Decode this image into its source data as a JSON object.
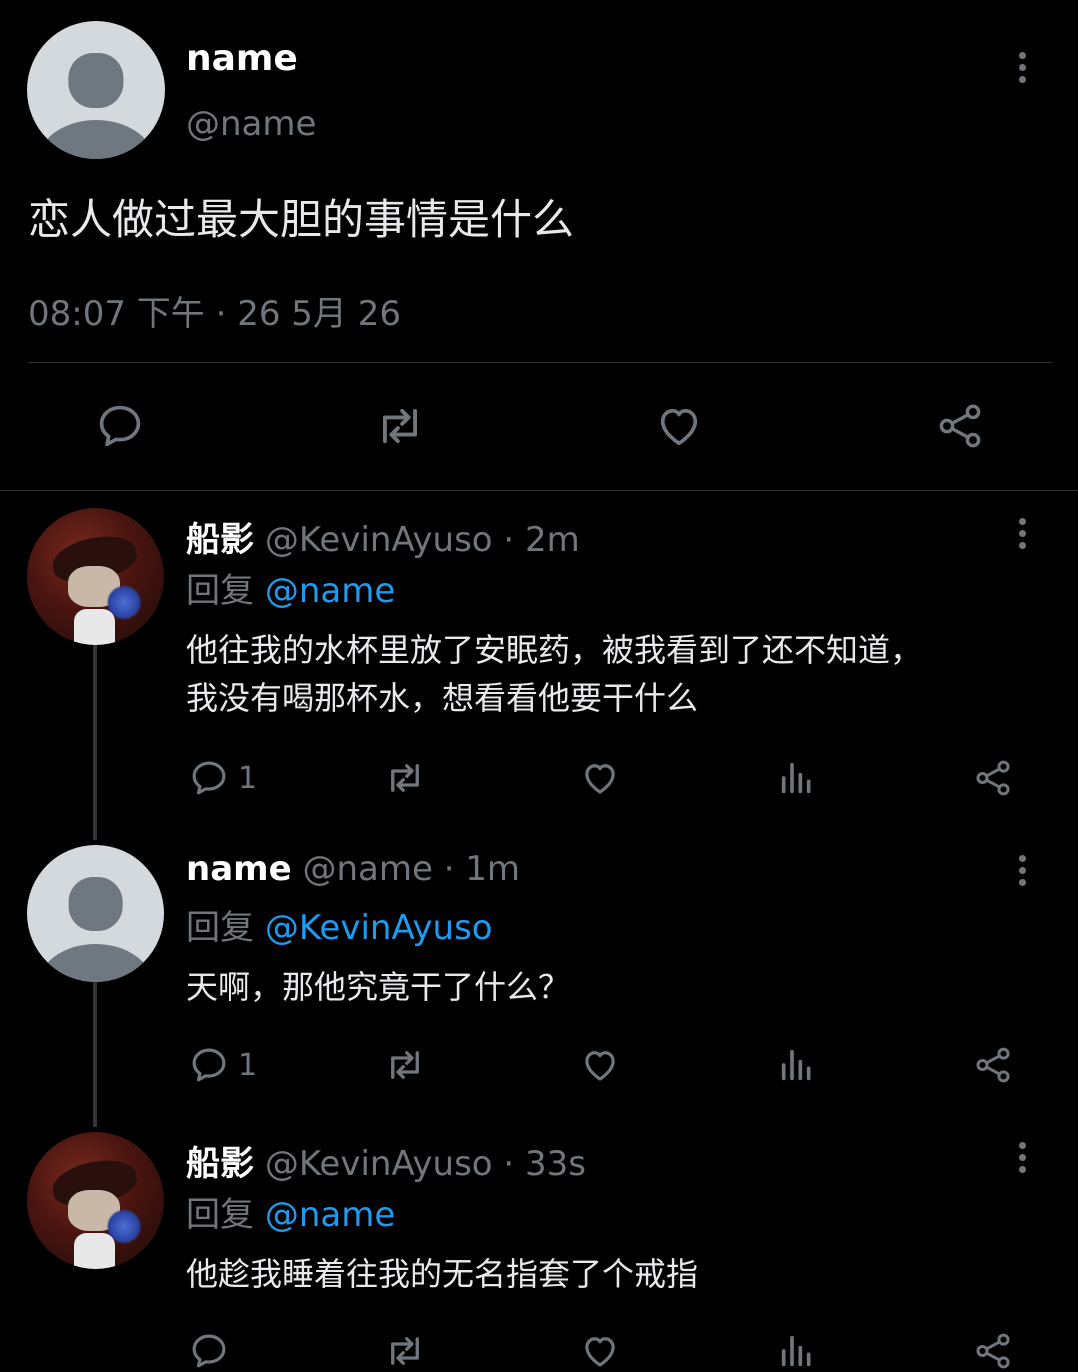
{
  "main_post": {
    "display_name": "name",
    "handle": "@name",
    "text": "恋人做过最大胆的事情是什么",
    "timestamp": "08:07 下午 · 26 5月 26"
  },
  "replies": [
    {
      "display_name": "船影",
      "handle": "@KevinAyuso",
      "time": "· 2m",
      "reply_prefix": "回复",
      "reply_to": "@name",
      "text_line1": "他往我的水杯里放了安眠药，被我看到了还不知道，",
      "text_line2": "我没有喝那杯水，想看看他要干什么",
      "reply_count": "1"
    },
    {
      "display_name": "name",
      "handle": "@name",
      "time": "· 1m",
      "reply_prefix": "回复",
      "reply_to": "@KevinAyuso",
      "text_line1": "天啊，那他究竟干了什么？",
      "reply_count": "1"
    },
    {
      "display_name": "船影",
      "handle": "@KevinAyuso",
      "time": "· 33s",
      "reply_prefix": "回复",
      "reply_to": "@name",
      "text_line1": "他趁我睡着往我的无名指套了个戒指"
    }
  ],
  "colors": {
    "background": "#000000",
    "muted": "#71767b",
    "link": "#1d9bf0",
    "divider": "#2f3336"
  }
}
